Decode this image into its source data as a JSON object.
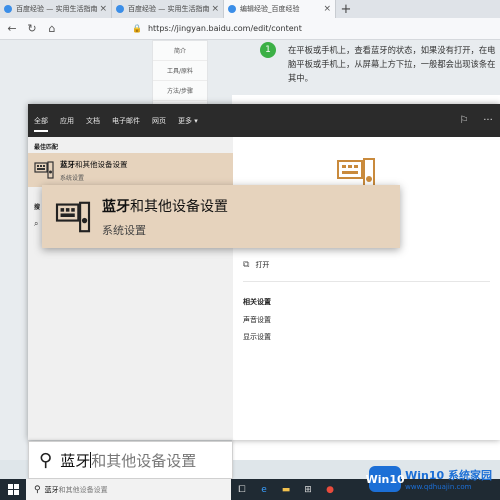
{
  "browser": {
    "tabs": [
      {
        "label": "百度经验 — 实用生活指南",
        "active": false
      },
      {
        "label": "百度经验 — 实用生活指南",
        "active": false
      },
      {
        "label": "编辑经验_百度经验",
        "active": true
      }
    ],
    "new_tab": "+",
    "url": "https://jingyan.baidu.com/edit/content"
  },
  "page": {
    "nav_items": [
      "简介",
      "工具/原料",
      "方法/步骤"
    ],
    "step_number": "1",
    "step_text": "在平板或手机上，查看蓝牙的状态，如果没有打开，在电脑平板或手机上，从屏幕上方下拉，一般都会出现该条在其中。",
    "edge_frags": [
      "\"蓝",
      "表,"
    ]
  },
  "search": {
    "filters": [
      "全部",
      "应用",
      "文档",
      "电子邮件",
      "网页",
      "更多 ▾"
    ],
    "best_match_title": "最佳匹配",
    "result": {
      "name_bold": "蓝牙",
      "name_rest": "和其他设备设置",
      "sub": "系统设置"
    },
    "web_heading": "搜",
    "detail": {
      "title": "设置",
      "open": "打开",
      "related_heading": "相关设置",
      "related": [
        "声音设置",
        "显示设置"
      ]
    },
    "query_typed": "蓝牙",
    "query_ghost": "和其他设备设置"
  },
  "taskbar": {
    "query_typed": "蓝牙",
    "query_ghost": "和其他设备设置"
  },
  "watermark": {
    "logo": "Win10",
    "title": "Win10 系统家园",
    "url": "www.qdhuajin.com"
  },
  "colors": {
    "accent": "#e6d3bd",
    "filterbar": "#2b2b2b",
    "taskbar": "#1f2a33",
    "brand_blue": "#1c6fd6"
  }
}
